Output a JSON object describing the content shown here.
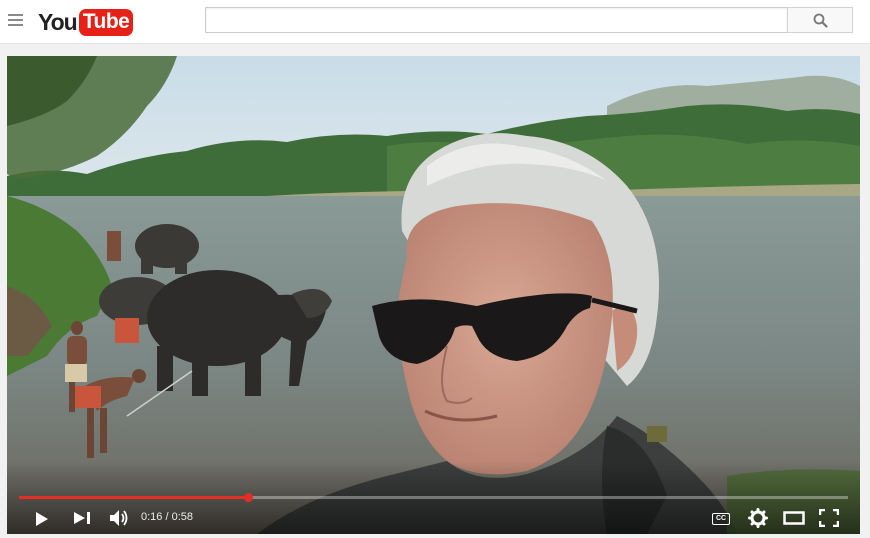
{
  "header": {
    "logo_you": "You",
    "logo_tube": "Tube",
    "search_placeholder": "",
    "menu_icon": "hamburger-menu-icon",
    "search_icon": "magnifier-search-icon"
  },
  "player": {
    "progress_fraction": 0.276,
    "current_time": "0:16",
    "separator": " / ",
    "duration": "0:58",
    "cc_label": "CC",
    "colors": {
      "progress": "#e52d27",
      "control": "#ffffff"
    },
    "icons": [
      "play-icon",
      "next-icon",
      "volume-icon",
      "captions-icon",
      "settings-gear-icon",
      "theater-mode-icon",
      "fullscreen-icon"
    ]
  }
}
